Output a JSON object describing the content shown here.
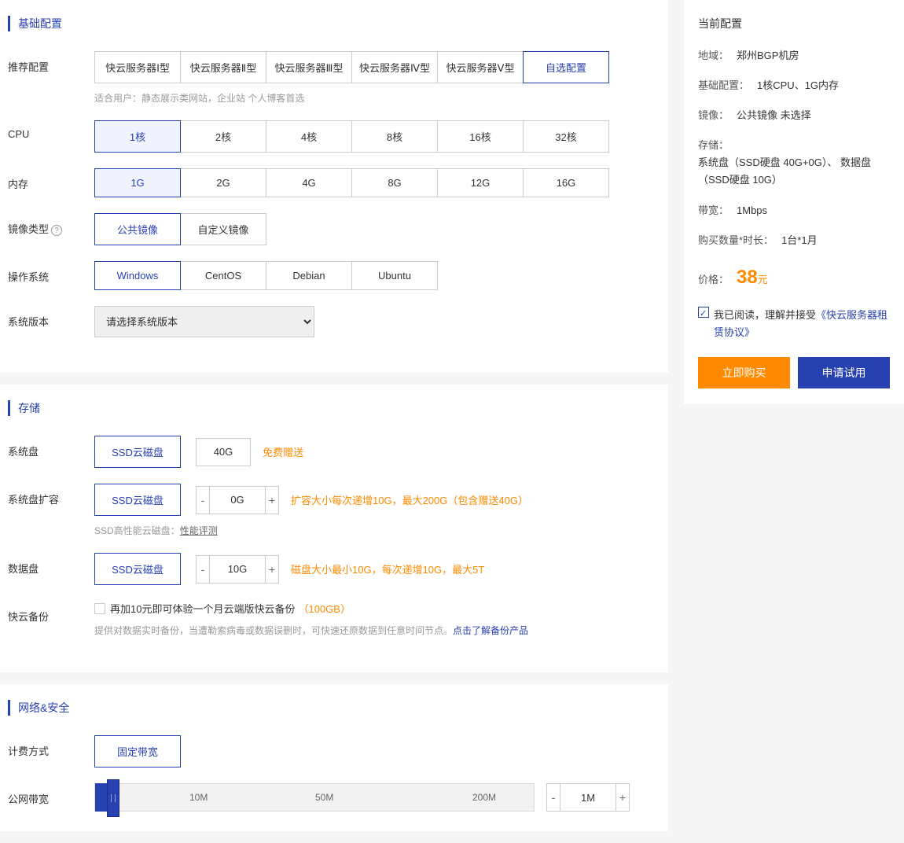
{
  "sections": {
    "basic": "基础配置",
    "storage": "存储",
    "network": "网络&安全"
  },
  "rec": {
    "label": "推荐配置",
    "opts": [
      "快云服务器Ⅰ型",
      "快云服务器Ⅱ型",
      "快云服务器Ⅲ型",
      "快云服务器Ⅳ型",
      "快云服务器Ⅴ型",
      "自选配置"
    ],
    "hint": "适合用户：静态展示类网站，企业站 个人博客首选"
  },
  "cpu": {
    "label": "CPU",
    "opts": [
      "1核",
      "2核",
      "4核",
      "8核",
      "16核",
      "32核"
    ]
  },
  "mem": {
    "label": "内存",
    "opts": [
      "1G",
      "2G",
      "4G",
      "8G",
      "12G",
      "16G"
    ]
  },
  "imgtype": {
    "label": "镜像类型",
    "help": "?",
    "opts": [
      "公共镜像",
      "自定义镜像"
    ]
  },
  "os": {
    "label": "操作系统",
    "opts": [
      "Windows",
      "CentOS",
      "Debian",
      "Ubuntu"
    ]
  },
  "sysver": {
    "label": "系统版本",
    "placeholder": "请选择系统版本"
  },
  "sysdisk": {
    "label": "系统盘",
    "type": "SSD云磁盘",
    "size": "40G",
    "note": "免费赠送"
  },
  "sysext": {
    "label": "系统盘扩容",
    "type": "SSD云磁盘",
    "val": "0G",
    "note": "扩容大小每次递增10G，最大200G（包含赠送40G）",
    "perf_pre": "SSD高性能云磁盘：",
    "perf_link": "性能评测"
  },
  "datadisk": {
    "label": "数据盘",
    "type": "SSD云磁盘",
    "val": "10G",
    "note": "磁盘大小最小10G，每次递增10G，最大5T"
  },
  "backup": {
    "label": "快云备份",
    "chk": "再加10元即可体验一个月云端版快云备份",
    "amt": "（100GB）",
    "hint_pre": "提供对数据实时备份，当遭勒索病毒或数据误删时，可快速还原数据到任意时间节点。",
    "hint_link": "点击了解备份产品"
  },
  "billing": {
    "label": "计费方式",
    "opt": "固定带宽"
  },
  "bw": {
    "label": "公网带宽",
    "ticks": [
      "10M",
      "50M",
      "200M"
    ],
    "val": "1M"
  },
  "side": {
    "title": "当前配置",
    "region_l": "地域：",
    "region_v": "郑州BGP机房",
    "basic_l": "基础配置：",
    "basic_v": "1核CPU、1G内存",
    "image_l": "镜像：",
    "image_v": "公共镜像 未选择",
    "stor_l": "存储：",
    "stor_v": "系统盘（SSD硬盘 40G+0G）、 数据盘（SSD硬盘 10G）",
    "bw_l": "带宽：",
    "bw_v": "1Mbps",
    "qty_l": "购买数量*时长：",
    "qty_v": "1台*1月",
    "price_l": "价格：",
    "price_n": "38",
    "price_u": "元",
    "agree_pre": "我已阅读，理解并接受",
    "agree_link": "《快云服务器租赁协议》",
    "buy": "立即购买",
    "trial": "申请试用"
  }
}
